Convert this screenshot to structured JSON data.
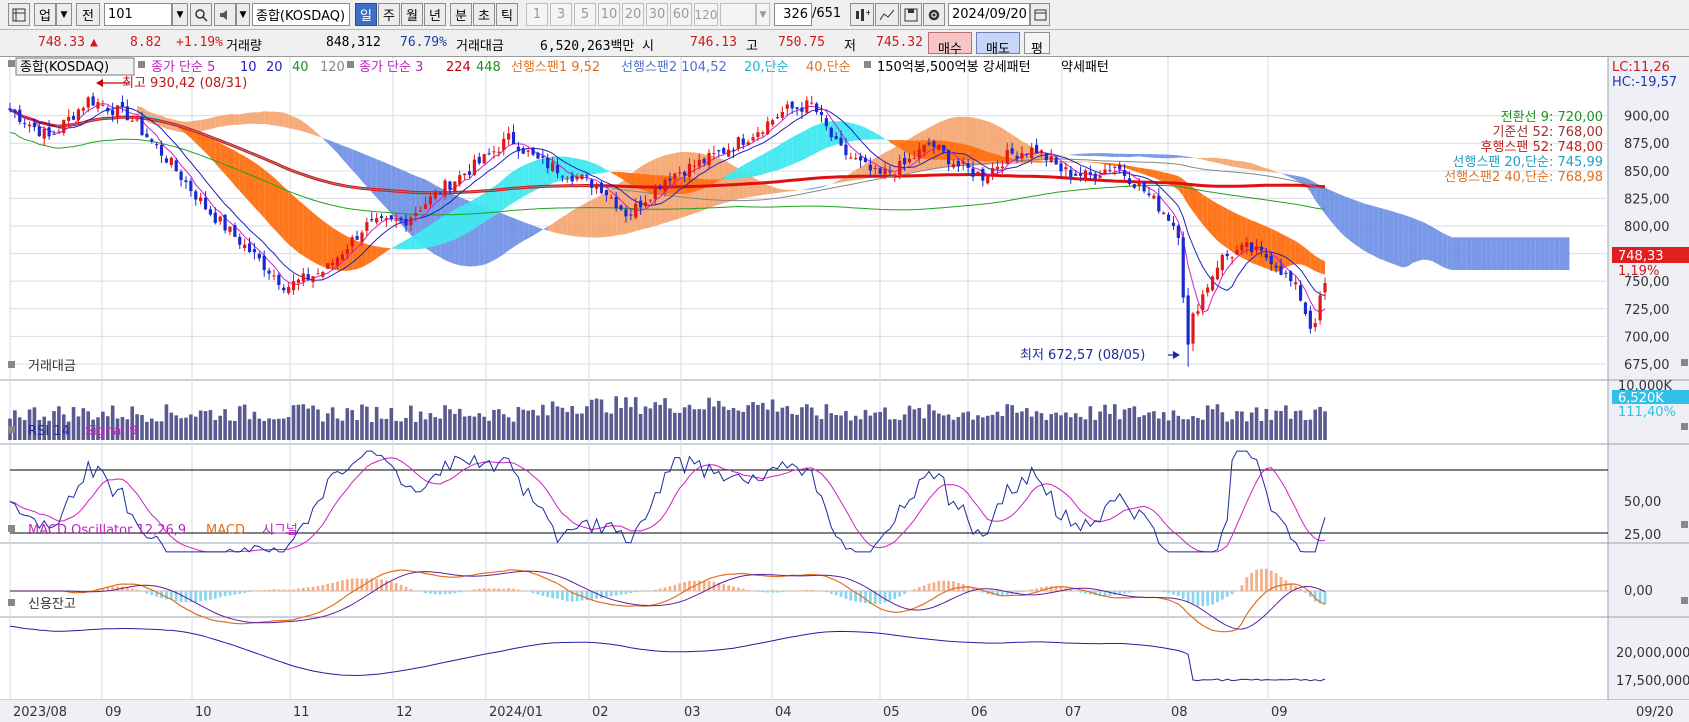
{
  "toolbar": {
    "market_label": "업",
    "prev_label": "전",
    "code": "101",
    "index_name": "종합(KOSDAQ)",
    "periods": [
      "일",
      "주",
      "월",
      "년",
      "분",
      "초",
      "틱"
    ],
    "minute_options": [
      "1",
      "3",
      "5",
      "10",
      "20",
      "30",
      "60",
      "120"
    ],
    "count": "326",
    "total": "/651",
    "date": "2024/09/20"
  },
  "info": {
    "price": "748.33",
    "arrow": "▲",
    "change": "8.82",
    "change_pct": "+1.19%",
    "volume_label": "거래량",
    "volume": "848,312",
    "volume_pct": "76.79%",
    "amount_label": "거래대금",
    "amount": "6,520,263백만",
    "open_label": "시",
    "open": "746.13",
    "high_label": "고",
    "high": "750.75",
    "low_label": "저",
    "low": "745.32",
    "buy_label": "매수",
    "sell_label": "매도",
    "eval_label": "평"
  },
  "legend": {
    "index": "종합(KOSDAQ)",
    "ma_label": "종가 단순 5",
    "ma10": "10",
    "ma20": "20",
    "ma40": "40",
    "ma120": "120",
    "ma_long_label": "종가 단순 3",
    "ma224": "224",
    "ma448": "448",
    "span1": "선행스팬1 9,52",
    "span2": "선행스팬2 104,52",
    "s20": "20,단순",
    "s40": "40,단순",
    "pattern": "150억봉,500억봉 강세패턴",
    "weak": "약세패턴"
  },
  "price_axis": {
    "ticks": [
      "900,00",
      "875,00",
      "850,00",
      "825,00",
      "800,00",
      "775,00",
      "750,00",
      "725,00",
      "700,00",
      "675,00"
    ],
    "lc": "LC:11,26",
    "hc": "HC:-19,57",
    "current": "748,33",
    "current_pct": "1,19%"
  },
  "ichimoku_labels": [
    {
      "text": "전환선 9: 720,00",
      "color": "#209020"
    },
    {
      "text": "기준선 52: 768,00",
      "color": "#a03030"
    },
    {
      "text": "후행스팬 52: 748,00",
      "color": "#c02020"
    },
    {
      "text": "선행스팬 20,단순: 745,99",
      "color": "#20a0c0"
    },
    {
      "text": "선행스팬2 40,단순: 768,98",
      "color": "#e07020"
    }
  ],
  "annotations": {
    "high": "최고 930,42 (08/31)",
    "low": "최저 672,57 (08/05)"
  },
  "volume_panel": {
    "title": "거래대금",
    "tick": "10,000K",
    "current": "6,520K",
    "pct": "111,40%"
  },
  "rsi_panel": {
    "title": "RSI 14",
    "signal": "Signal 9",
    "ticks": [
      "50,00",
      "25,00"
    ]
  },
  "macd_panel": {
    "title": "MACD Oscillator 12,26,9",
    "macd": "MACD",
    "signal": "시그널",
    "tick": "0,00"
  },
  "credit_panel": {
    "title": "신용잔고",
    "ticks": [
      "20,000,000",
      "17,500,000"
    ]
  },
  "time_axis": {
    "labels": [
      "2023/08",
      "09",
      "10",
      "11",
      "12",
      "2024/01",
      "02",
      "03",
      "04",
      "05",
      "06",
      "07",
      "08",
      "09"
    ],
    "end_label": "09/20"
  },
  "chart_data": {
    "type": "candlestick",
    "title": "종합(KOSDAQ)",
    "x_period": [
      "2023/08",
      "2024/09/20"
    ],
    "ylim": [
      665,
      935
    ],
    "close_path": [
      [
        0,
        905
      ],
      [
        0.03,
        880
      ],
      [
        0.06,
        915
      ],
      [
        0.09,
        900
      ],
      [
        0.12,
        860
      ],
      [
        0.15,
        815
      ],
      [
        0.18,
        780
      ],
      [
        0.21,
        745
      ],
      [
        0.24,
        760
      ],
      [
        0.27,
        800
      ],
      [
        0.3,
        805
      ],
      [
        0.33,
        835
      ],
      [
        0.36,
        860
      ],
      [
        0.38,
        880
      ],
      [
        0.4,
        860
      ],
      [
        0.42,
        850
      ],
      [
        0.45,
        835
      ],
      [
        0.47,
        810
      ],
      [
        0.5,
        845
      ],
      [
        0.53,
        860
      ],
      [
        0.56,
        880
      ],
      [
        0.59,
        905
      ],
      [
        0.61,
        910
      ],
      [
        0.63,
        870
      ],
      [
        0.66,
        845
      ],
      [
        0.68,
        855
      ],
      [
        0.7,
        875
      ],
      [
        0.72,
        855
      ],
      [
        0.74,
        845
      ],
      [
        0.76,
        865
      ],
      [
        0.78,
        870
      ],
      [
        0.8,
        850
      ],
      [
        0.82,
        845
      ],
      [
        0.84,
        855
      ],
      [
        0.86,
        835
      ],
      [
        0.88,
        810
      ],
      [
        0.89,
        792
      ],
      [
        0.895,
        672.57
      ],
      [
        0.9,
        720
      ],
      [
        0.92,
        770
      ],
      [
        0.94,
        780
      ],
      [
        0.96,
        770
      ],
      [
        0.98,
        740
      ],
      [
        0.99,
        705
      ],
      [
        1.0,
        748.33
      ]
    ],
    "high": {
      "value": 930.42,
      "date": "08/31"
    },
    "low": {
      "value": 672.57,
      "date": "08/05"
    },
    "last": 748.33
  }
}
